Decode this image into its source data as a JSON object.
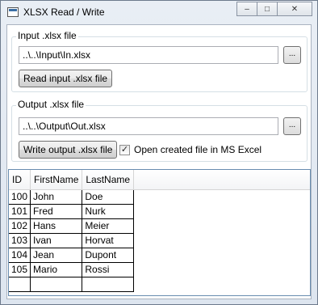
{
  "window": {
    "title": "XLSX Read / Write",
    "minimize_glyph": "–",
    "maximize_glyph": "□",
    "close_glyph": "✕"
  },
  "input_group": {
    "title": "Input .xlsx file",
    "path_value": "..\\..\\Input\\In.xlsx",
    "browse_label": "...",
    "read_button_label": "Read input .xlsx file"
  },
  "output_group": {
    "title": "Output .xlsx file",
    "path_value": "..\\..\\Output\\Out.xlsx",
    "browse_label": "...",
    "write_button_label": "Write output .xlsx file",
    "open_in_excel_label": "Open created file in MS Excel",
    "open_in_excel_checked": true,
    "check_glyph": "✓"
  },
  "grid": {
    "columns": [
      "ID",
      "FirstName",
      "LastName"
    ],
    "rows": [
      [
        "100",
        "John",
        "Doe"
      ],
      [
        "101",
        "Fred",
        "Nurk"
      ],
      [
        "102",
        "Hans",
        "Meier"
      ],
      [
        "103",
        "Ivan",
        "Horvat"
      ],
      [
        "104",
        "Jean",
        "Dupont"
      ],
      [
        "105",
        "Mario",
        "Rossi"
      ]
    ]
  }
}
